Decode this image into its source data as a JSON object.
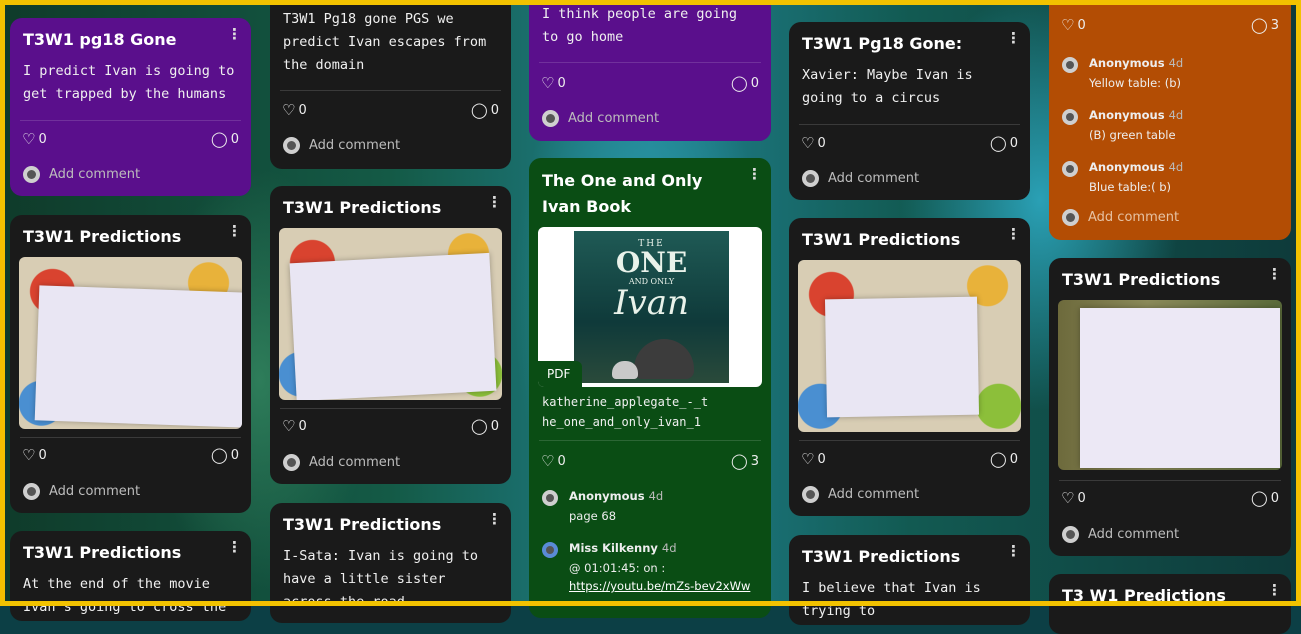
{
  "icons": {
    "like": "heart-outline-icon",
    "comment": "speech-bubble-icon",
    "more": "kebab-menu-icon",
    "avatar": "user-avatar-icon"
  },
  "colors": {
    "border": "#f2c200",
    "card_dark": "#1a1a1a",
    "card_purple": "#5a0f8c",
    "card_green": "#0a4d14",
    "card_orange": "#b34d04"
  },
  "common": {
    "add_comment": "Add comment",
    "more": "⋮",
    "like_glyph": "♡",
    "comment_glyph": "◯"
  },
  "col1": {
    "card1": {
      "title": "T3W1 pg18 Gone",
      "body": "I predict Ivan is going to get trapped by the humans",
      "likes": "0",
      "comments": "0"
    },
    "card2": {
      "title": "T3W1 Predictions",
      "likes": "0",
      "comments": "0"
    },
    "card3": {
      "title": "T3W1 Predictions",
      "body": "At the end of the movie Ivan's going to cross the road to the"
    }
  },
  "col2": {
    "card1": {
      "body": "T3W1 Pg18 gone PGS we predict Ivan escapes from the domain",
      "likes": "0",
      "comments": "0"
    },
    "card2": {
      "title": "T3W1 Predictions",
      "likes": "0",
      "comments": "0"
    },
    "card3": {
      "title": "T3W1 Predictions",
      "body": "I-Sata: Ivan is going to have a little sister across the road."
    }
  },
  "col3": {
    "card1": {
      "body": "I think people are going to go home",
      "likes": "0",
      "comments": "0"
    },
    "card2": {
      "title": "The One and Only Ivan Book",
      "pdf_label": "PDF",
      "cover_line1": "THE",
      "cover_line2": "ONE",
      "cover_line3": "AND ONLY",
      "cover_line4": "Ivan",
      "filename": "katherine_applegate_-_the_one_and_only_ivan_1",
      "likes": "0",
      "comments": "3",
      "comment_list": [
        {
          "name": "Anonymous",
          "time": "4d",
          "text": "page 68"
        },
        {
          "name": "Miss Kilkenny",
          "time": "4d",
          "text": "@ 01:01:45: on :",
          "link": "https://youtu.be/mZs-bev2xWw"
        }
      ]
    }
  },
  "col4": {
    "card1": {
      "title": "T3W1 Pg18 Gone:",
      "body": "Xavier: Maybe Ivan is going to a circus",
      "likes": "0",
      "comments": "0"
    },
    "card2": {
      "title": "T3W1 Predictions",
      "likes": "0",
      "comments": "0"
    },
    "card3": {
      "title": "T3W1 Predictions",
      "body": "I believe that Ivan is trying to"
    }
  },
  "col5": {
    "card1": {
      "likes": "0",
      "comments": "3",
      "comment_list": [
        {
          "name": "Anonymous",
          "time": "4d",
          "text": "Yellow table: (b)"
        },
        {
          "name": "Anonymous",
          "time": "4d",
          "text": "(B) green table"
        },
        {
          "name": "Anonymous",
          "time": "4d",
          "text": "Blue table:( b)"
        }
      ]
    },
    "card2": {
      "title": "T3W1 Predictions",
      "likes": "0",
      "comments": "0"
    },
    "card3": {
      "title": "T3 W1 Predictions"
    }
  }
}
